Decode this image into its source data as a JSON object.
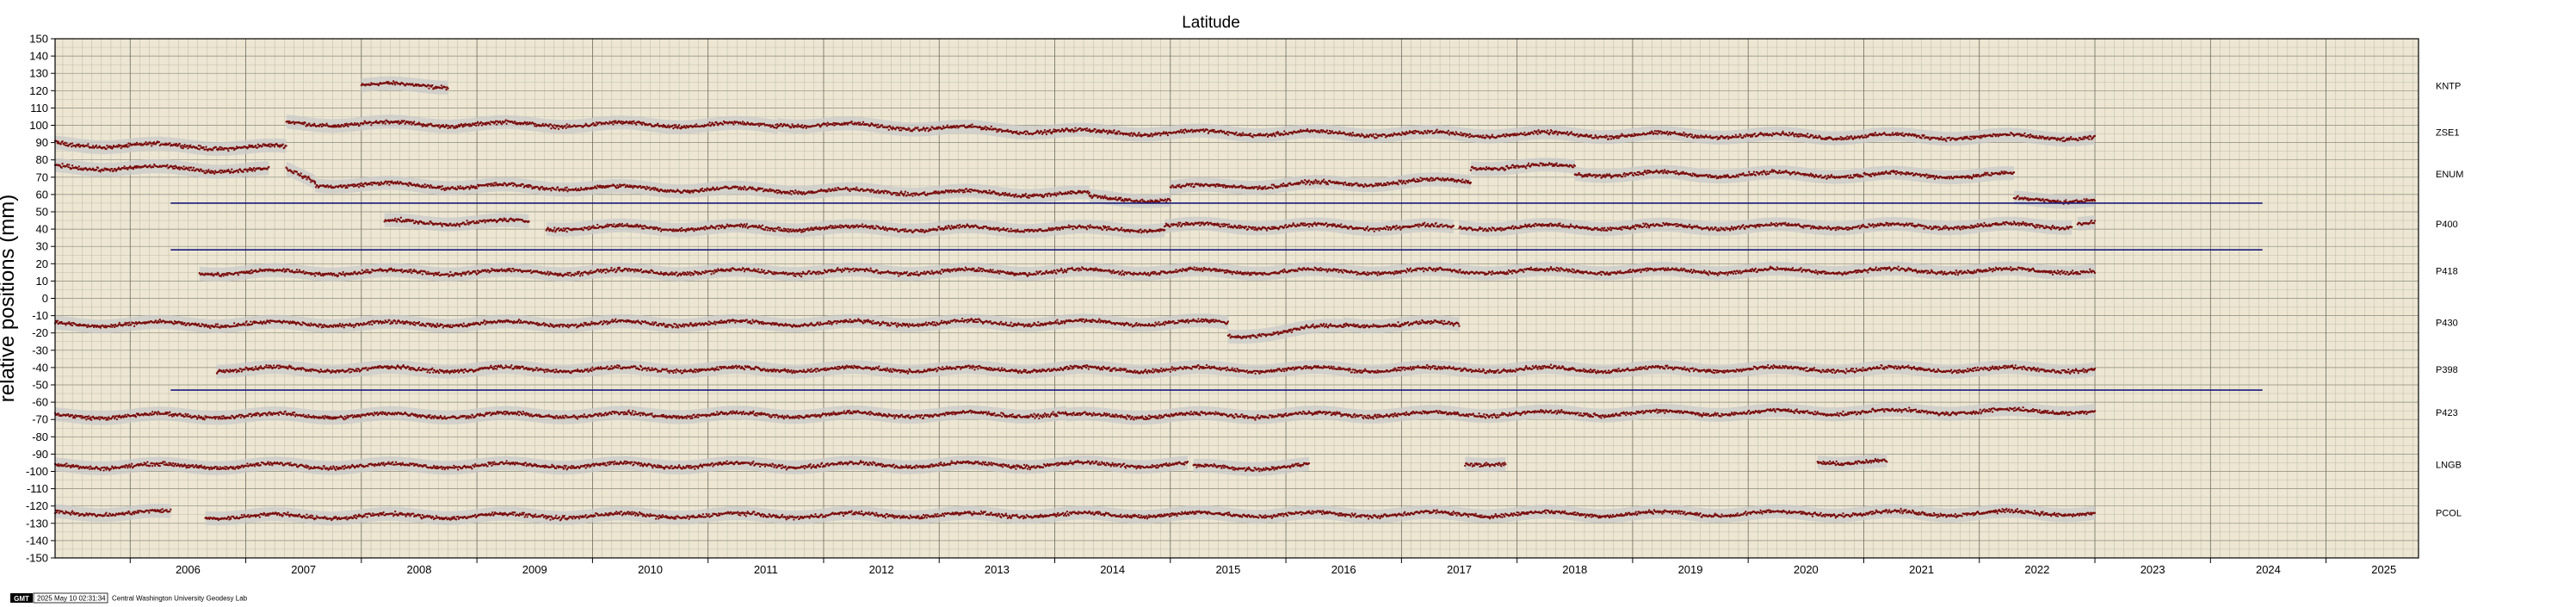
{
  "chart_data": {
    "type": "scatter",
    "title": "Latitude",
    "ylabel": "relative positions (mm)",
    "xlabel": "",
    "xlim": [
      2005.35,
      2025.8
    ],
    "ylim": [
      -150,
      150
    ],
    "y_ticks": [
      150,
      140,
      130,
      120,
      110,
      100,
      90,
      80,
      70,
      60,
      50,
      40,
      30,
      20,
      10,
      0,
      -10,
      -20,
      -30,
      -40,
      -50,
      -60,
      -70,
      -80,
      -90,
      -100,
      -110,
      -120,
      -130,
      -140,
      -150
    ],
    "x_ticks": [
      2006,
      2007,
      2008,
      2009,
      2010,
      2011,
      2012,
      2013,
      2014,
      2015,
      2016,
      2017,
      2018,
      2019,
      2020,
      2021,
      2022,
      2023,
      2024,
      2025
    ],
    "grid": true,
    "background": "#ece6d2",
    "point_color": "#7a0c0c",
    "band_color": "#c9c9c9",
    "hline_color": "#1a1a7a",
    "series": [
      {
        "name": "KNTP",
        "offset": 123,
        "segments": [
          [
            2008.0,
            2008.75,
            123,
            123
          ]
        ]
      },
      {
        "name": "ZSE1",
        "offset": 96,
        "segments": [
          [
            2005.35,
            2007.35,
            89,
            87
          ],
          [
            2007.35,
            2011.6,
            101,
            100
          ],
          [
            2011.6,
            2014.3,
            101,
            96
          ],
          [
            2014.3,
            2023.0,
            96,
            93
          ]
        ]
      },
      {
        "name": "ENUM",
        "offset": 72,
        "segments": [
          [
            2005.35,
            2007.2,
            76,
            74
          ],
          [
            2007.35,
            2007.6,
            74,
            68
          ],
          [
            2007.6,
            2014.3,
            66,
            60
          ],
          [
            2014.3,
            2015.0,
            58,
            57
          ],
          [
            2015.0,
            2017.6,
            64,
            68
          ],
          [
            2017.6,
            2018.5,
            76,
            76
          ],
          [
            2018.5,
            2022.3,
            72,
            71
          ],
          [
            2022.3,
            2023.0,
            57,
            57
          ]
        ]
      },
      {
        "name": "P400",
        "offset": 43,
        "segments": [
          [
            2008.2,
            2009.45,
            44,
            44
          ],
          [
            2009.6,
            2014.95,
            41,
            40
          ],
          [
            2014.95,
            2017.45,
            42,
            41
          ],
          [
            2017.5,
            2022.8,
            41,
            42
          ],
          [
            2022.85,
            2023.0,
            44,
            44
          ]
        ]
      },
      {
        "name": "P418",
        "offset": 16,
        "segments": [
          [
            2006.6,
            2023.0,
            15,
            16
          ]
        ]
      },
      {
        "name": "P430",
        "offset": -14,
        "segments": [
          [
            2005.35,
            2015.5,
            -15,
            -14
          ],
          [
            2015.5,
            2016.5,
            -22,
            -16
          ],
          [
            2016.5,
            2017.5,
            -15,
            -15
          ]
        ]
      },
      {
        "name": "P398",
        "offset": -41,
        "segments": [
          [
            2006.75,
            2023.0,
            -41,
            -41
          ]
        ]
      },
      {
        "name": "P423",
        "offset": -66,
        "segments": [
          [
            2005.35,
            2014.1,
            -68,
            -67
          ],
          [
            2014.1,
            2023.0,
            -68,
            -65
          ]
        ]
      },
      {
        "name": "LNGB",
        "offset": -96,
        "segments": [
          [
            2005.35,
            2015.15,
            -97,
            -96
          ],
          [
            2015.2,
            2016.2,
            -98,
            -97
          ],
          [
            2017.55,
            2017.9,
            -95,
            -95
          ],
          [
            2020.6,
            2021.2,
            -94,
            -95
          ]
        ]
      },
      {
        "name": "PCOL",
        "offset": -124,
        "segments": [
          [
            2005.35,
            2006.35,
            -124,
            -124
          ],
          [
            2006.65,
            2023.0,
            -126,
            -124
          ]
        ]
      }
    ],
    "reference_lines": [
      {
        "y": 55,
        "x0": 2006.35,
        "x1": 2024.45
      },
      {
        "y": 28,
        "x0": 2006.35,
        "x1": 2024.45
      },
      {
        "y": -53,
        "x0": 2006.35,
        "x1": 2024.45
      }
    ]
  },
  "footer": {
    "gmt_logo": "GMT",
    "timestamp": "2025 May 10 02:31:34",
    "lab": "Central Washington University Geodesy Lab"
  }
}
